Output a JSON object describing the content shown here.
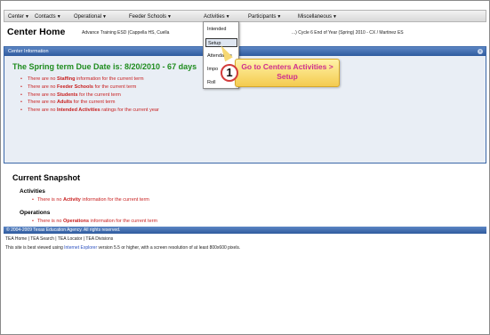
{
  "menubar": {
    "items": [
      "Center",
      "Contacts",
      "Operational",
      "Feeder Schools",
      "Activities",
      "Participants",
      "Miscellaneous"
    ]
  },
  "header": {
    "title": "Center Home",
    "subtitle_left": "Advance Training ESD (Cappella HS, Cuella",
    "subtitle_right": "...) Cycle 6 End of Year (Spring) 2010 - CX / Martinez ES"
  },
  "info_panel": {
    "heading": "Center Information",
    "due_line": "The Spring term Due Date is: 8/20/2010 - 67 days",
    "bullets": [
      {
        "pre": "There are no ",
        "bold": "Staffing",
        "post": " information for the current term"
      },
      {
        "pre": "There are no ",
        "bold": "Feeder Schools",
        "post": " for the current term"
      },
      {
        "pre": "There are no ",
        "bold": "Students",
        "post": " for the current term"
      },
      {
        "pre": "There are no ",
        "bold": "Adults",
        "post": " for the current term"
      },
      {
        "pre": "There are no ",
        "bold": "Intended Activities",
        "post": " ratings for the current year"
      }
    ]
  },
  "snapshot": {
    "title": "Current Snapshot",
    "activities": {
      "heading": "Activities",
      "pre": "There is no ",
      "bold": "Activity",
      "post": " information for the current term"
    },
    "operations": {
      "heading": "Operations",
      "pre": "There is no ",
      "bold": "Operations",
      "post": " information for the current term"
    }
  },
  "footer": {
    "copyright": "© 2004-2009 Texas Education Agency. All rights reserved.",
    "links": [
      "TEA Home",
      "TEA Search",
      "TEA Locator",
      "TEA Divisions"
    ],
    "note_pre": "This site is best viewed using ",
    "note_link": "Internet Explorer",
    "note_post": " version 5.5 or higher, with a screen resolution of at least 800x600 pixels."
  },
  "dropdown": {
    "items": [
      "Intended",
      "Setup",
      "Attendance",
      "Impo",
      "Roll"
    ],
    "highlighted_index": 1
  },
  "callout": {
    "number": "1",
    "line1": "Go to Centers Activities >",
    "line2": "Setup"
  },
  "colors": {
    "panel_header": "#2f5b9e",
    "due_text": "#1e8c1e",
    "warning_text": "#c81e1e",
    "callout_text": "#ce2f8f",
    "callout_fill": "#f4cb4f"
  }
}
